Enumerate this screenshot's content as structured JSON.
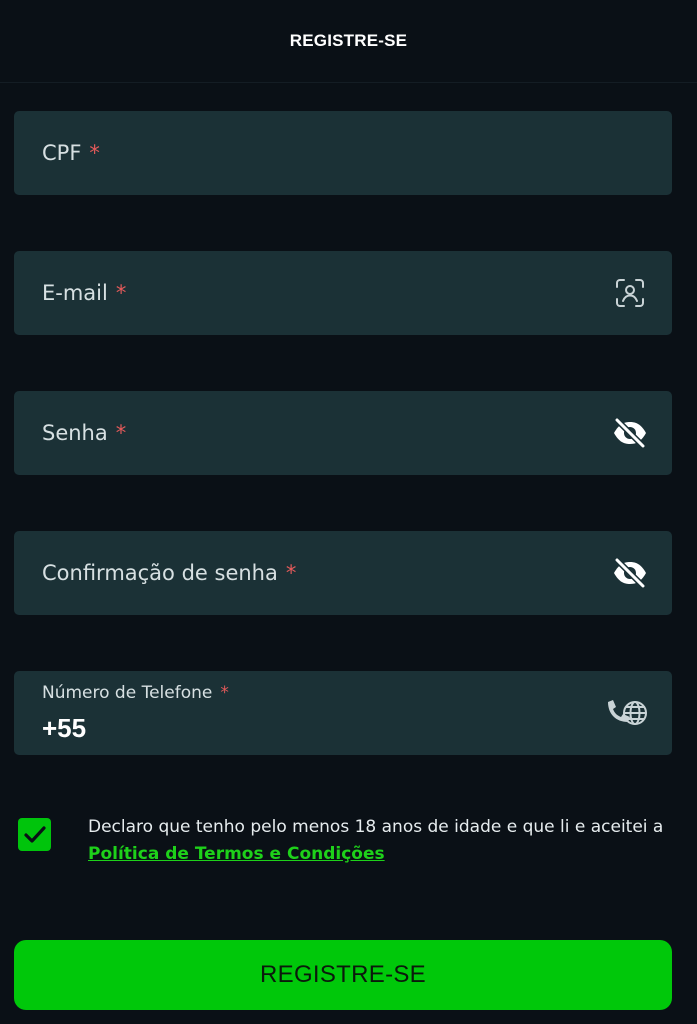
{
  "header": {
    "title": "REGISTRE-SE"
  },
  "form": {
    "cpf": {
      "label": "CPF",
      "required": "*"
    },
    "email": {
      "label": "E-mail",
      "required": "*",
      "icon": "user-scan-icon"
    },
    "password": {
      "label": "Senha",
      "required": "*",
      "icon": "eye-off-icon"
    },
    "password_confirm": {
      "label": "Confirmação de senha",
      "required": "*",
      "icon": "eye-off-icon"
    },
    "phone": {
      "label": "Número de Telefone",
      "required": "*",
      "value": "+55",
      "icon": "phone-globe-icon"
    }
  },
  "terms": {
    "checked": true,
    "text": "Declaro que tenho pelo menos 18 anos de idade e que li e aceitei a ",
    "link": "Política de Termos e Condições"
  },
  "submit": {
    "label": "REGISTRE-SE"
  },
  "colors": {
    "background": "#0a1016",
    "field_bg": "#1b3136",
    "accent_green": "#00c80a",
    "required_red": "#e35a5a",
    "link_green": "#1ed11a"
  }
}
